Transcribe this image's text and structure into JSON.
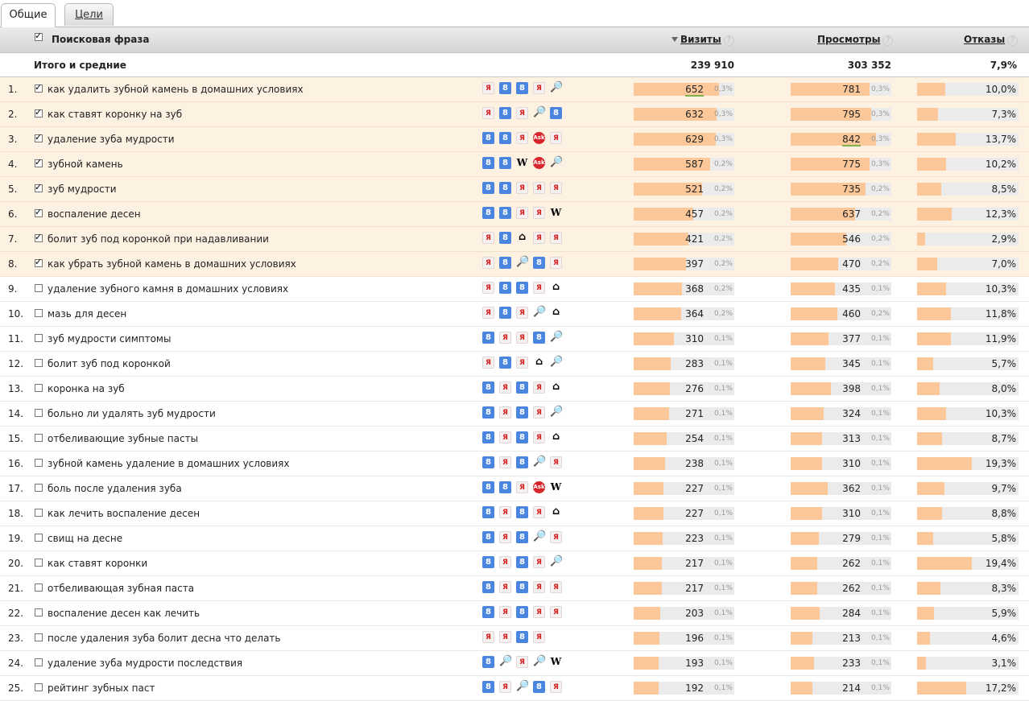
{
  "tabs": [
    {
      "label": "Общие"
    },
    {
      "label": "Цели"
    }
  ],
  "header": {
    "phrase": "Поисковая фраза",
    "visits": "Визиты",
    "views": "Просмотры",
    "bounces": "Отказы",
    "help": "?"
  },
  "totals": {
    "label": "Итого и средние",
    "visits": "239 910",
    "views": "303 352",
    "bounces": "7,9%"
  },
  "rows": [
    {
      "n": "1.",
      "checked": true,
      "text": "как удалить зубной камень в домашних условиях",
      "icons": [
        "yandex",
        "google",
        "google",
        "yandex",
        "search"
      ],
      "visits": "652",
      "vpct": "0,3%",
      "views": "781",
      "wpct": "0,3%",
      "rate": "10,0%",
      "r": 0.1,
      "vu": true,
      "wu": false
    },
    {
      "n": "2.",
      "checked": true,
      "text": "как ставят коронку на зуб",
      "icons": [
        "yandex",
        "google",
        "yandex",
        "search",
        "google"
      ],
      "visits": "632",
      "vpct": "0,3%",
      "views": "795",
      "wpct": "0,3%",
      "rate": "7,3%",
      "r": 0.073,
      "vu": false,
      "wu": false
    },
    {
      "n": "3.",
      "checked": true,
      "text": "удаление зуба мудрости",
      "icons": [
        "google",
        "google",
        "yandex",
        "ask",
        "yandex"
      ],
      "visits": "629",
      "vpct": "0,3%",
      "views": "842",
      "wpct": "0,3%",
      "rate": "13,7%",
      "r": 0.137,
      "vu": false,
      "wu": true
    },
    {
      "n": "4.",
      "checked": true,
      "text": "зубной камень",
      "icons": [
        "google",
        "google",
        "wiki",
        "ask",
        "search"
      ],
      "visits": "587",
      "vpct": "0,2%",
      "views": "775",
      "wpct": "0,3%",
      "rate": "10,2%",
      "r": 0.102,
      "vu": false,
      "wu": false
    },
    {
      "n": "5.",
      "checked": true,
      "text": "зуб мудрости",
      "icons": [
        "google",
        "google",
        "yandex",
        "yandex",
        "yandex"
      ],
      "visits": "521",
      "vpct": "0,2%",
      "views": "735",
      "wpct": "0,2%",
      "rate": "8,5%",
      "r": 0.085,
      "vu": false,
      "wu": false
    },
    {
      "n": "6.",
      "checked": true,
      "text": "воспаление десен",
      "icons": [
        "google",
        "google",
        "yandex",
        "yandex",
        "wiki"
      ],
      "visits": "457",
      "vpct": "0,2%",
      "views": "637",
      "wpct": "0,2%",
      "rate": "12,3%",
      "r": 0.123,
      "vu": false,
      "wu": false
    },
    {
      "n": "7.",
      "checked": true,
      "text": "болит зуб под коронкой при надавливании",
      "icons": [
        "yandex",
        "google",
        "home",
        "yandex",
        "yandex"
      ],
      "visits": "421",
      "vpct": "0,2%",
      "views": "546",
      "wpct": "0,2%",
      "rate": "2,9%",
      "r": 0.029,
      "vu": false,
      "wu": false
    },
    {
      "n": "8.",
      "checked": true,
      "text": "как убрать зубной камень в домашних условиях",
      "icons": [
        "yandex",
        "google",
        "search",
        "google",
        "yandex"
      ],
      "visits": "397",
      "vpct": "0,2%",
      "views": "470",
      "wpct": "0,2%",
      "rate": "7,0%",
      "r": 0.07,
      "vu": false,
      "wu": false
    },
    {
      "n": "9.",
      "checked": false,
      "text": "удаление зубного камня в домашних условиях",
      "icons": [
        "yandex",
        "google",
        "google",
        "yandex",
        "home"
      ],
      "visits": "368",
      "vpct": "0,2%",
      "views": "435",
      "wpct": "0,1%",
      "rate": "10,3%",
      "r": 0.103,
      "vu": false,
      "wu": false
    },
    {
      "n": "10.",
      "checked": false,
      "text": "мазь для десен",
      "icons": [
        "yandex",
        "google",
        "yandex",
        "search",
        "home"
      ],
      "visits": "364",
      "vpct": "0,2%",
      "views": "460",
      "wpct": "0,2%",
      "rate": "11,8%",
      "r": 0.118,
      "vu": false,
      "wu": false
    },
    {
      "n": "11.",
      "checked": false,
      "text": "зуб мудрости симптомы",
      "icons": [
        "google",
        "yandex",
        "yandex",
        "google",
        "search"
      ],
      "visits": "310",
      "vpct": "0,1%",
      "views": "377",
      "wpct": "0,1%",
      "rate": "11,9%",
      "r": 0.119,
      "vu": false,
      "wu": false
    },
    {
      "n": "12.",
      "checked": false,
      "text": "болит зуб под коронкой",
      "icons": [
        "yandex",
        "google",
        "yandex",
        "home",
        "search"
      ],
      "visits": "283",
      "vpct": "0,1%",
      "views": "345",
      "wpct": "0,1%",
      "rate": "5,7%",
      "r": 0.057,
      "vu": false,
      "wu": false
    },
    {
      "n": "13.",
      "checked": false,
      "text": "коронка на зуб",
      "icons": [
        "google",
        "yandex",
        "google",
        "yandex",
        "home"
      ],
      "visits": "276",
      "vpct": "0,1%",
      "views": "398",
      "wpct": "0,1%",
      "rate": "8,0%",
      "r": 0.08,
      "vu": false,
      "wu": false
    },
    {
      "n": "14.",
      "checked": false,
      "text": "больно ли удалять зуб мудрости",
      "icons": [
        "google",
        "yandex",
        "google",
        "yandex",
        "search"
      ],
      "visits": "271",
      "vpct": "0,1%",
      "views": "324",
      "wpct": "0,1%",
      "rate": "10,3%",
      "r": 0.103,
      "vu": false,
      "wu": false
    },
    {
      "n": "15.",
      "checked": false,
      "text": "отбеливающие зубные пасты",
      "icons": [
        "google",
        "yandex",
        "google",
        "yandex",
        "home"
      ],
      "visits": "254",
      "vpct": "0,1%",
      "views": "313",
      "wpct": "0,1%",
      "rate": "8,7%",
      "r": 0.087,
      "vu": false,
      "wu": false
    },
    {
      "n": "16.",
      "checked": false,
      "text": "зубной камень удаление в домашних условиях",
      "icons": [
        "google",
        "yandex",
        "google",
        "search",
        "yandex"
      ],
      "visits": "238",
      "vpct": "0,1%",
      "views": "310",
      "wpct": "0,1%",
      "rate": "19,3%",
      "r": 0.193,
      "vu": false,
      "wu": false
    },
    {
      "n": "17.",
      "checked": false,
      "text": "боль после удаления зуба",
      "icons": [
        "google",
        "google",
        "yandex",
        "ask",
        "wiki"
      ],
      "visits": "227",
      "vpct": "0,1%",
      "views": "362",
      "wpct": "0,1%",
      "rate": "9,7%",
      "r": 0.097,
      "vu": false,
      "wu": false
    },
    {
      "n": "18.",
      "checked": false,
      "text": "как лечить воспаление десен",
      "icons": [
        "google",
        "yandex",
        "google",
        "yandex",
        "home"
      ],
      "visits": "227",
      "vpct": "0,1%",
      "views": "310",
      "wpct": "0,1%",
      "rate": "8,8%",
      "r": 0.088,
      "vu": false,
      "wu": false
    },
    {
      "n": "19.",
      "checked": false,
      "text": "свищ на десне",
      "icons": [
        "google",
        "yandex",
        "google",
        "search",
        "yandex"
      ],
      "visits": "223",
      "vpct": "0,1%",
      "views": "279",
      "wpct": "0,1%",
      "rate": "5,8%",
      "r": 0.058,
      "vu": false,
      "wu": false
    },
    {
      "n": "20.",
      "checked": false,
      "text": "как ставят коронки",
      "icons": [
        "google",
        "yandex",
        "google",
        "yandex",
        "search"
      ],
      "visits": "217",
      "vpct": "0,1%",
      "views": "262",
      "wpct": "0,1%",
      "rate": "19,4%",
      "r": 0.194,
      "vu": false,
      "wu": false
    },
    {
      "n": "21.",
      "checked": false,
      "text": "отбеливающая зубная паста",
      "icons": [
        "google",
        "yandex",
        "google",
        "yandex",
        "yandex"
      ],
      "visits": "217",
      "vpct": "0,1%",
      "views": "262",
      "wpct": "0,1%",
      "rate": "8,3%",
      "r": 0.083,
      "vu": false,
      "wu": false
    },
    {
      "n": "22.",
      "checked": false,
      "text": "воспаление десен как лечить",
      "icons": [
        "google",
        "yandex",
        "google",
        "yandex",
        "yandex"
      ],
      "visits": "203",
      "vpct": "0,1%",
      "views": "284",
      "wpct": "0,1%",
      "rate": "5,9%",
      "r": 0.059,
      "vu": false,
      "wu": false
    },
    {
      "n": "23.",
      "checked": false,
      "text": "после удаления зуба болит десна что делать",
      "icons": [
        "yandex",
        "yandex",
        "google",
        "yandex"
      ],
      "visits": "196",
      "vpct": "0,1%",
      "views": "213",
      "wpct": "0,1%",
      "rate": "4,6%",
      "r": 0.046,
      "vu": false,
      "wu": false
    },
    {
      "n": "24.",
      "checked": false,
      "text": "удаление зуба мудрости последствия",
      "icons": [
        "google",
        "search",
        "yandex",
        "search",
        "wiki"
      ],
      "visits": "193",
      "vpct": "0,1%",
      "views": "233",
      "wpct": "0,1%",
      "rate": "3,1%",
      "r": 0.031,
      "vu": false,
      "wu": false
    },
    {
      "n": "25.",
      "checked": false,
      "text": "рейтинг зубных паст",
      "icons": [
        "google",
        "yandex",
        "search",
        "google",
        "yandex"
      ],
      "visits": "192",
      "vpct": "0,1%",
      "views": "214",
      "wpct": "0,1%",
      "rate": "17,2%",
      "r": 0.172,
      "vu": false,
      "wu": false
    }
  ],
  "icon_glyphs": {
    "google": "8",
    "yandex": "Я",
    "search": "🔎",
    "ask": "Ask",
    "home": "⌂",
    "wiki": "W"
  },
  "colors": {
    "bar": "#fcc89a",
    "selected_row": "#fdf1e2",
    "track": "#ebebeb",
    "google_icon": "#4a86e0",
    "yandex_icon": "#d72020"
  }
}
